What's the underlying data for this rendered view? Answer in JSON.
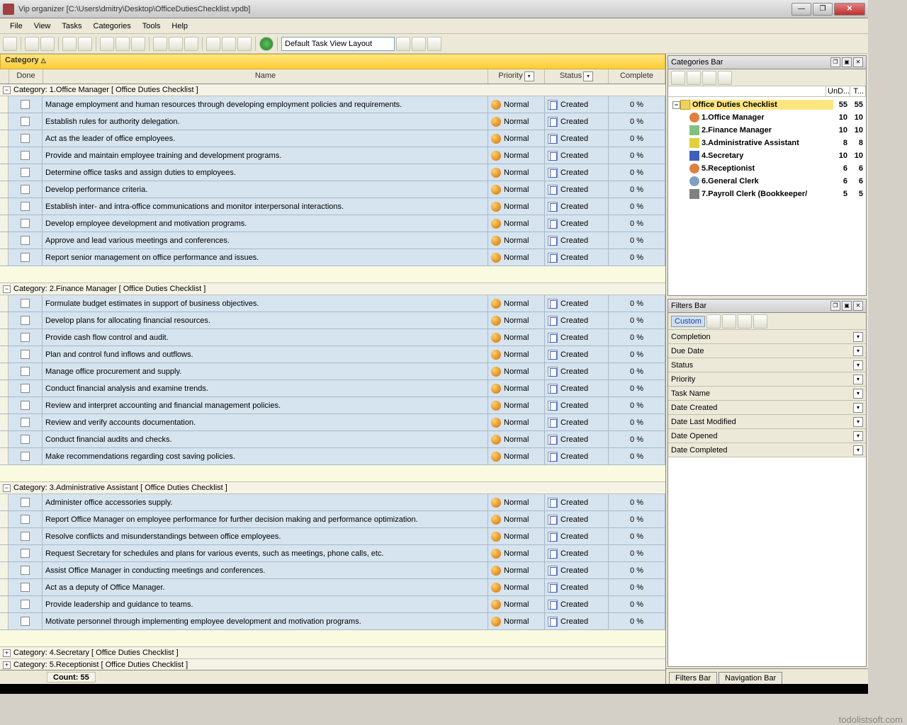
{
  "titlebar": {
    "title": "Vip organizer [C:\\Users\\dmitry\\Desktop\\OfficeDutiesChecklist.vpdb]"
  },
  "menu": [
    "File",
    "View",
    "Tasks",
    "Categories",
    "Tools",
    "Help"
  ],
  "toolbar": {
    "layout_combo": "Default Task View Layout"
  },
  "grid": {
    "group_label": "Category",
    "columns": {
      "done": "Done",
      "name": "Name",
      "priority": "Priority",
      "status": "Status",
      "complete": "Complete"
    },
    "count_label": "Count:  55",
    "groups": [
      {
        "title": "Category: 1.Office Manager    [ Office Duties Checklist ]",
        "expanded": true,
        "rows": [
          {
            "name": "Manage employment and human resources through developing employment policies and requirements.",
            "priority": "Normal",
            "status": "Created",
            "complete": "0 %"
          },
          {
            "name": "Establish rules for authority delegation.",
            "priority": "Normal",
            "status": "Created",
            "complete": "0 %"
          },
          {
            "name": "Act as the leader of office employees.",
            "priority": "Normal",
            "status": "Created",
            "complete": "0 %"
          },
          {
            "name": "Provide and maintain employee training and development programs.",
            "priority": "Normal",
            "status": "Created",
            "complete": "0 %"
          },
          {
            "name": "Determine office tasks and assign duties to employees.",
            "priority": "Normal",
            "status": "Created",
            "complete": "0 %"
          },
          {
            "name": "Develop performance criteria.",
            "priority": "Normal",
            "status": "Created",
            "complete": "0 %"
          },
          {
            "name": "Establish inter- and intra-office communications and monitor interpersonal interactions.",
            "priority": "Normal",
            "status": "Created",
            "complete": "0 %"
          },
          {
            "name": "Develop employee development and motivation programs.",
            "priority": "Normal",
            "status": "Created",
            "complete": "0 %"
          },
          {
            "name": "Approve and lead various meetings and conferences.",
            "priority": "Normal",
            "status": "Created",
            "complete": "0 %"
          },
          {
            "name": "Report senior management on office performance and issues.",
            "priority": "Normal",
            "status": "Created",
            "complete": "0 %"
          }
        ]
      },
      {
        "title": "Category: 2.Finance Manager    [ Office Duties Checklist ]",
        "expanded": true,
        "rows": [
          {
            "name": "Formulate budget estimates in support of business objectives.",
            "priority": "Normal",
            "status": "Created",
            "complete": "0 %"
          },
          {
            "name": "Develop plans for allocating financial resources.",
            "priority": "Normal",
            "status": "Created",
            "complete": "0 %"
          },
          {
            "name": "Provide cash flow control and audit.",
            "priority": "Normal",
            "status": "Created",
            "complete": "0 %"
          },
          {
            "name": "Plan and control fund inflows and outflows.",
            "priority": "Normal",
            "status": "Created",
            "complete": "0 %"
          },
          {
            "name": "Manage office procurement and supply.",
            "priority": "Normal",
            "status": "Created",
            "complete": "0 %"
          },
          {
            "name": "Conduct financial analysis and examine trends.",
            "priority": "Normal",
            "status": "Created",
            "complete": "0 %"
          },
          {
            "name": "Review and interpret accounting and financial management policies.",
            "priority": "Normal",
            "status": "Created",
            "complete": "0 %"
          },
          {
            "name": "Review and verify accounts documentation.",
            "priority": "Normal",
            "status": "Created",
            "complete": "0 %"
          },
          {
            "name": "Conduct financial audits and checks.",
            "priority": "Normal",
            "status": "Created",
            "complete": "0 %"
          },
          {
            "name": "Make recommendations regarding cost saving policies.",
            "priority": "Normal",
            "status": "Created",
            "complete": "0 %"
          }
        ]
      },
      {
        "title": "Category: 3.Administrative Assistant    [ Office Duties Checklist ]",
        "expanded": true,
        "rows": [
          {
            "name": "Administer office accessories supply.",
            "priority": "Normal",
            "status": "Created",
            "complete": "0 %"
          },
          {
            "name": "Report Office Manager on employee performance for further decision making and performance optimization.",
            "priority": "Normal",
            "status": "Created",
            "complete": "0 %"
          },
          {
            "name": "Resolve conflicts and misunderstandings between office employees.",
            "priority": "Normal",
            "status": "Created",
            "complete": "0 %"
          },
          {
            "name": "Request Secretary for schedules and plans for various events, such as meetings, phone calls, etc.",
            "priority": "Normal",
            "status": "Created",
            "complete": "0 %"
          },
          {
            "name": "Assist Office Manager in conducting meetings and conferences.",
            "priority": "Normal",
            "status": "Created",
            "complete": "0 %"
          },
          {
            "name": "Act as a deputy of Office Manager.",
            "priority": "Normal",
            "status": "Created",
            "complete": "0 %"
          },
          {
            "name": "Provide leadership and guidance to teams.",
            "priority": "Normal",
            "status": "Created",
            "complete": "0 %"
          },
          {
            "name": "Motivate personnel through implementing employee development and motivation programs.",
            "priority": "Normal",
            "status": "Created",
            "complete": "0 %"
          }
        ]
      },
      {
        "title": "Category: 4.Secretary    [ Office Duties Checklist ]",
        "expanded": false,
        "rows": []
      },
      {
        "title": "Category: 5.Receptionist    [ Office Duties Checklist ]",
        "expanded": false,
        "rows": []
      }
    ]
  },
  "categories_bar": {
    "title": "Categories Bar",
    "header_cols": [
      "",
      "UnD...",
      "T..."
    ],
    "root": {
      "label": "Office Duties Checklist",
      "c1": "55",
      "c2": "55"
    },
    "items": [
      {
        "icon": "ti-person",
        "label": "1.Office Manager",
        "c1": "10",
        "c2": "10"
      },
      {
        "icon": "ti-doc",
        "label": "2.Finance Manager",
        "c1": "10",
        "c2": "10"
      },
      {
        "icon": "ti-key",
        "label": "3.Administrative Assistant",
        "c1": "8",
        "c2": "8"
      },
      {
        "icon": "ti-flag",
        "label": "4.Secretary",
        "c1": "10",
        "c2": "10"
      },
      {
        "icon": "ti-person",
        "label": "5.Receptionist",
        "c1": "6",
        "c2": "6"
      },
      {
        "icon": "ti-clock",
        "label": "6.General Clerk",
        "c1": "6",
        "c2": "6"
      },
      {
        "icon": "ti-calc",
        "label": "7.Payroll Clerk (Bookkeeper/",
        "c1": "5",
        "c2": "5"
      }
    ]
  },
  "filters_bar": {
    "title": "Filters Bar",
    "custom": "Custom",
    "fields": [
      "Completion",
      "Due Date",
      "Status",
      "Priority",
      "Task Name",
      "Date Created",
      "Date Last Modified",
      "Date Opened",
      "Date Completed"
    ]
  },
  "bottom_tabs": [
    "Filters Bar",
    "Navigation Bar"
  ],
  "watermark": "todolistsoft.com"
}
